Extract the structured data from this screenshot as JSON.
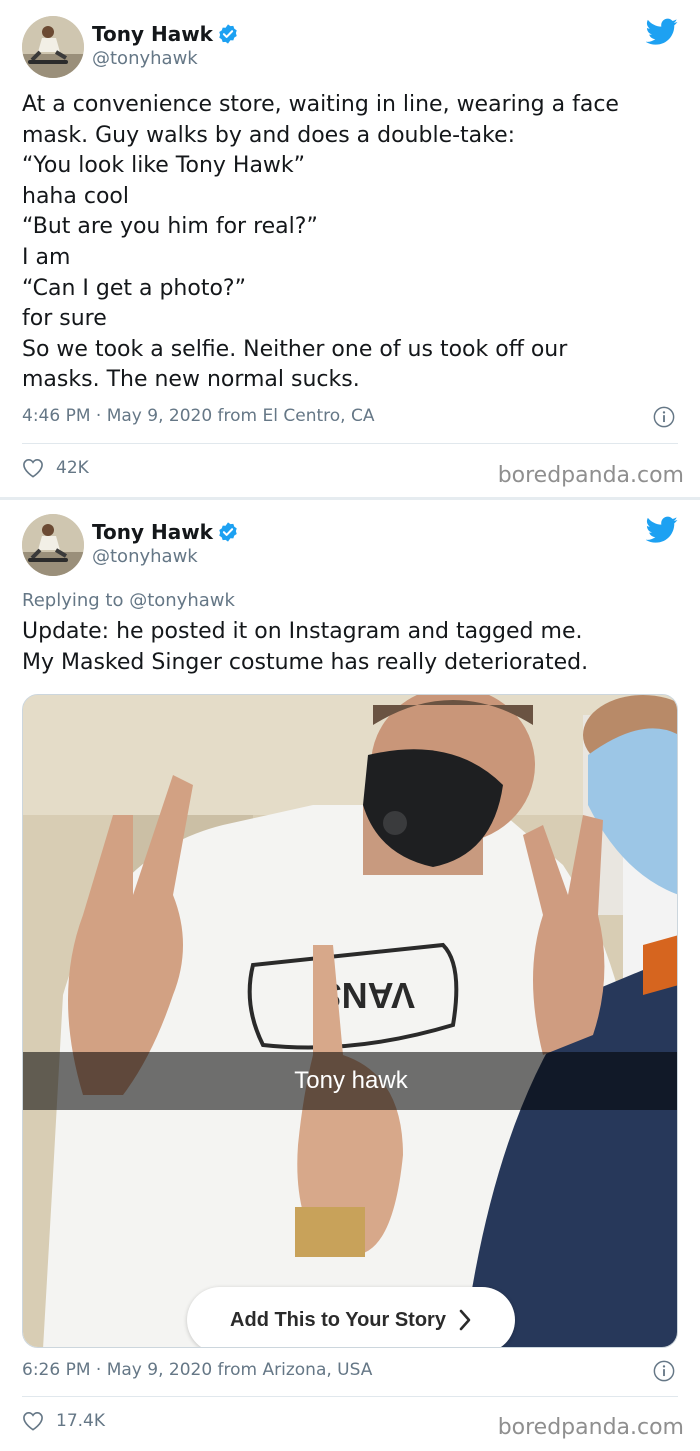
{
  "tweets": [
    {
      "name": "Tony Hawk",
      "handle": "@tonyhawk",
      "lines": [
        "At a convenience store, waiting in line, wearing a face",
        "mask. Guy walks by and does a double-take:",
        "“You look like Tony Hawk”",
        "haha cool",
        "“But are you him for real?”",
        "I am",
        "“Can I get a photo?”",
        "for sure",
        "So we took a selfie. Neither one of us took off our",
        "masks. The new normal sucks."
      ],
      "meta": "4:46 PM · May 9, 2020 from El Centro, CA",
      "likes": "42K",
      "brand": "boredpanda.com"
    },
    {
      "name": "Tony Hawk",
      "handle": "@tonyhawk",
      "replying": "Replying to @tonyhawk",
      "lines": [
        "Update: he posted it on Instagram and tagged me.",
        "My Masked Singer costume has really deteriorated."
      ],
      "photo": {
        "shirt_logo": "VANS",
        "caption": "Tony hawk",
        "story_button": "Add This to Your Story"
      },
      "meta": "6:26 PM · May 9, 2020 from Arizona, USA",
      "likes": "17.4K",
      "brand": "boredpanda.com"
    }
  ],
  "colors": {
    "accent": "#1da1f2",
    "text": "#14171a",
    "secondary": "#657786"
  },
  "icons": [
    "verified-badge-icon",
    "twitter-bird-icon",
    "info-icon",
    "heart-icon",
    "chevron-right-icon"
  ]
}
